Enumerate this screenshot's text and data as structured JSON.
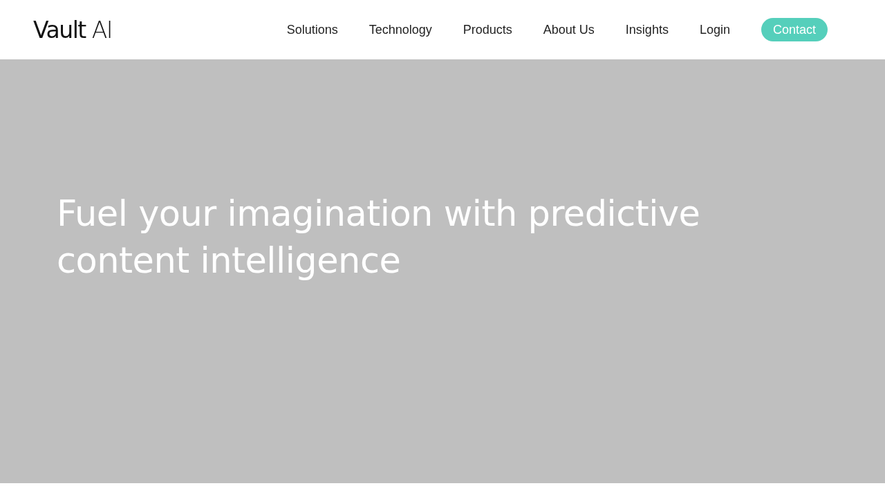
{
  "header": {
    "logo": "**Vault** AI",
    "nav": [
      {
        "label": "Solutions",
        "kind": "link"
      },
      {
        "label": "Technology",
        "kind": "link"
      },
      {
        "label": "Products",
        "kind": "link"
      },
      {
        "label": "About Us",
        "kind": "link"
      },
      {
        "label": "Insights",
        "kind": "link"
      },
      {
        "label": "Login",
        "kind": "link"
      },
      {
        "label": "Contact",
        "kind": "button"
      }
    ]
  },
  "hero": {
    "heading": "Fuel your imagination with predictive content intelligence"
  }
}
